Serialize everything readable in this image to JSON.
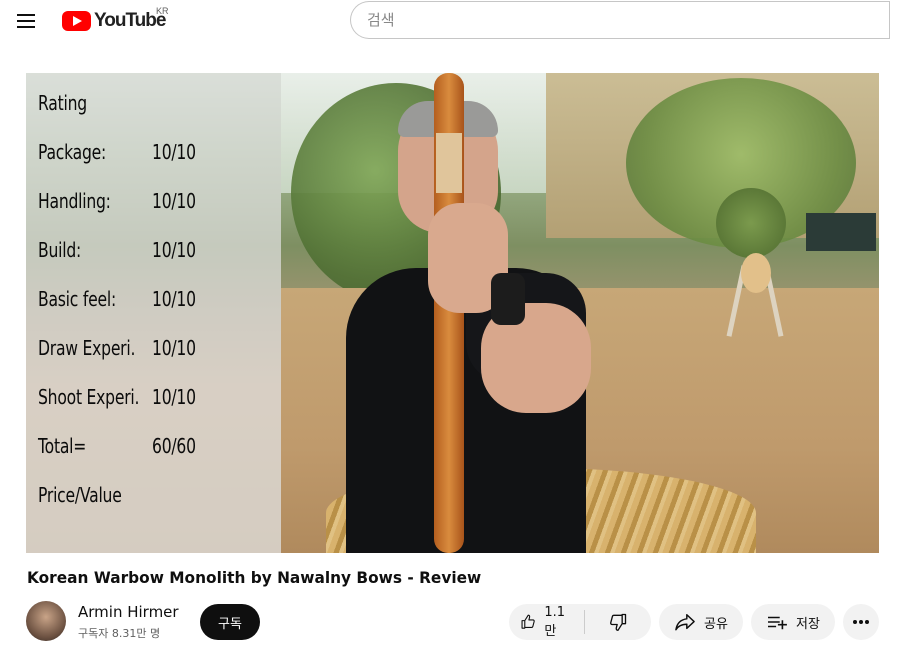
{
  "header": {
    "logo_text": "YouTube",
    "region": "KR",
    "search_placeholder": "검색"
  },
  "video": {
    "overlay": {
      "heading": "Rating",
      "rows": [
        {
          "label": "Package:",
          "score": "10/10"
        },
        {
          "label": "Handling:",
          "score": "10/10"
        },
        {
          "label": "Build:",
          "score": "10/10"
        },
        {
          "label": "Basic feel:",
          "score": "10/10"
        },
        {
          "label": "Draw Experi.",
          "score": "10/10"
        },
        {
          "label": "Shoot Experi.",
          "score": "10/10"
        },
        {
          "label": "Total=",
          "score": "60/60"
        },
        {
          "label": "Price/Value",
          "score": ""
        }
      ]
    },
    "title": "Korean Warbow Monolith by Nawalny Bows - Review"
  },
  "channel": {
    "name": "Armin Hirmer",
    "subscribers": "구독자 8.31만 명",
    "subscribe_label": "구독"
  },
  "actions": {
    "like_count": "1.1만",
    "share_label": "공유",
    "save_label": "저장"
  },
  "colors": {
    "brand_red": "#ff0000",
    "pill_bg": "#f2f2f2",
    "subscribe_bg": "#0f0f0f"
  },
  "icons": [
    "menu-icon",
    "youtube-logo-icon",
    "thumbs-up-icon",
    "thumbs-down-icon",
    "share-arrow-icon",
    "add-playlist-icon",
    "more-dots-icon"
  ]
}
